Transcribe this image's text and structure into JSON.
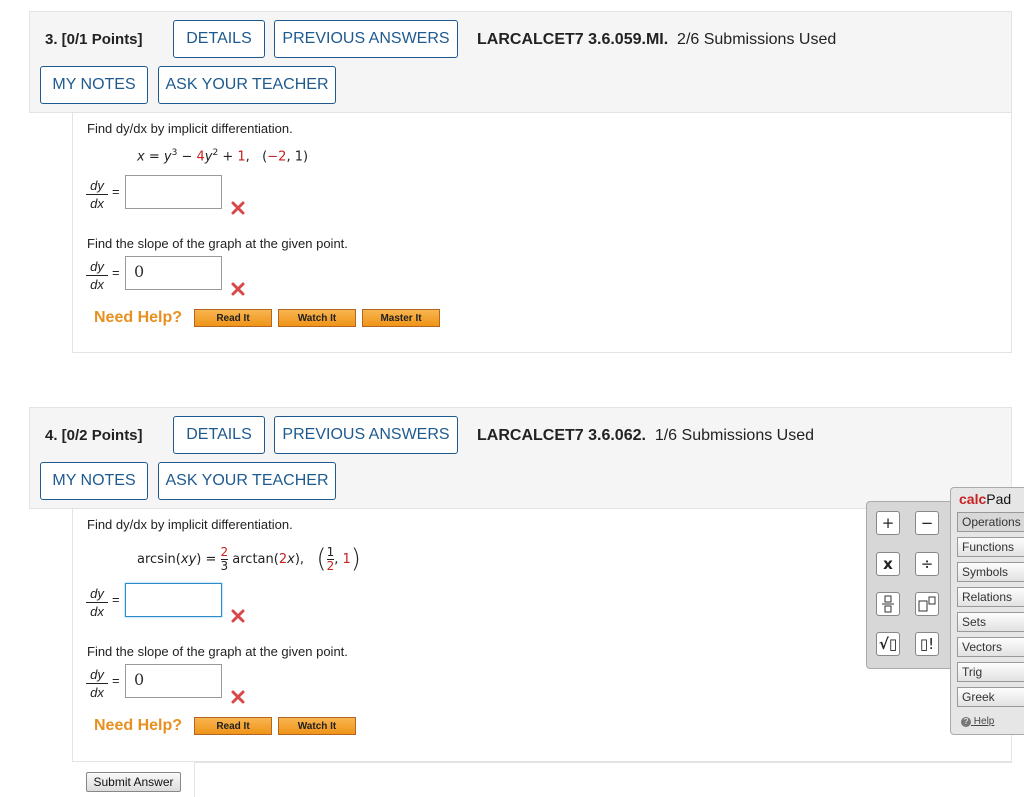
{
  "q3": {
    "label": "3. [0/1 Points]",
    "details": "DETAILS",
    "previous": "PREVIOUS ANSWERS",
    "code": "LARCALCET7 3.6.059.MI.",
    "submissions": "2/6 Submissions Used",
    "my_notes": "MY NOTES",
    "ask_teacher": "ASK YOUR TEACHER",
    "prompt": "Find dy/dx by implicit differentiation.",
    "equation": "x = y³ − 4y² + 1,   (−2, 1)",
    "deriv_value": "",
    "slope_prompt": "Find the slope of the graph at the given point.",
    "slope_value": "0",
    "need_help": "Need Help?",
    "read_it": "Read It",
    "watch_it": "Watch It",
    "master_it": "Master It"
  },
  "q4": {
    "label": "4. [0/2 Points]",
    "details": "DETAILS",
    "previous": "PREVIOUS ANSWERS",
    "code": "LARCALCET7 3.6.062.",
    "submissions": "1/6 Submissions Used",
    "my_notes": "MY NOTES",
    "ask_teacher": "ASK YOUR TEACHER",
    "prompt": "Find dy/dx by implicit differentiation.",
    "deriv_value": "",
    "slope_prompt": "Find the slope of the graph at the given point.",
    "slope_value": "0",
    "need_help": "Need Help?",
    "read_it": "Read It",
    "watch_it": "Watch It",
    "submit": "Submit Answer"
  },
  "calcpad": {
    "title_a": "calc",
    "title_b": "Pad",
    "tabs": [
      "Operations",
      "Functions",
      "Symbols",
      "Relations",
      "Sets",
      "Vectors",
      "Trig",
      "Greek"
    ],
    "help": "Help"
  },
  "colors": {
    "accent": "#1f5a8f",
    "error": "#c62020",
    "help": "#e8901f"
  }
}
